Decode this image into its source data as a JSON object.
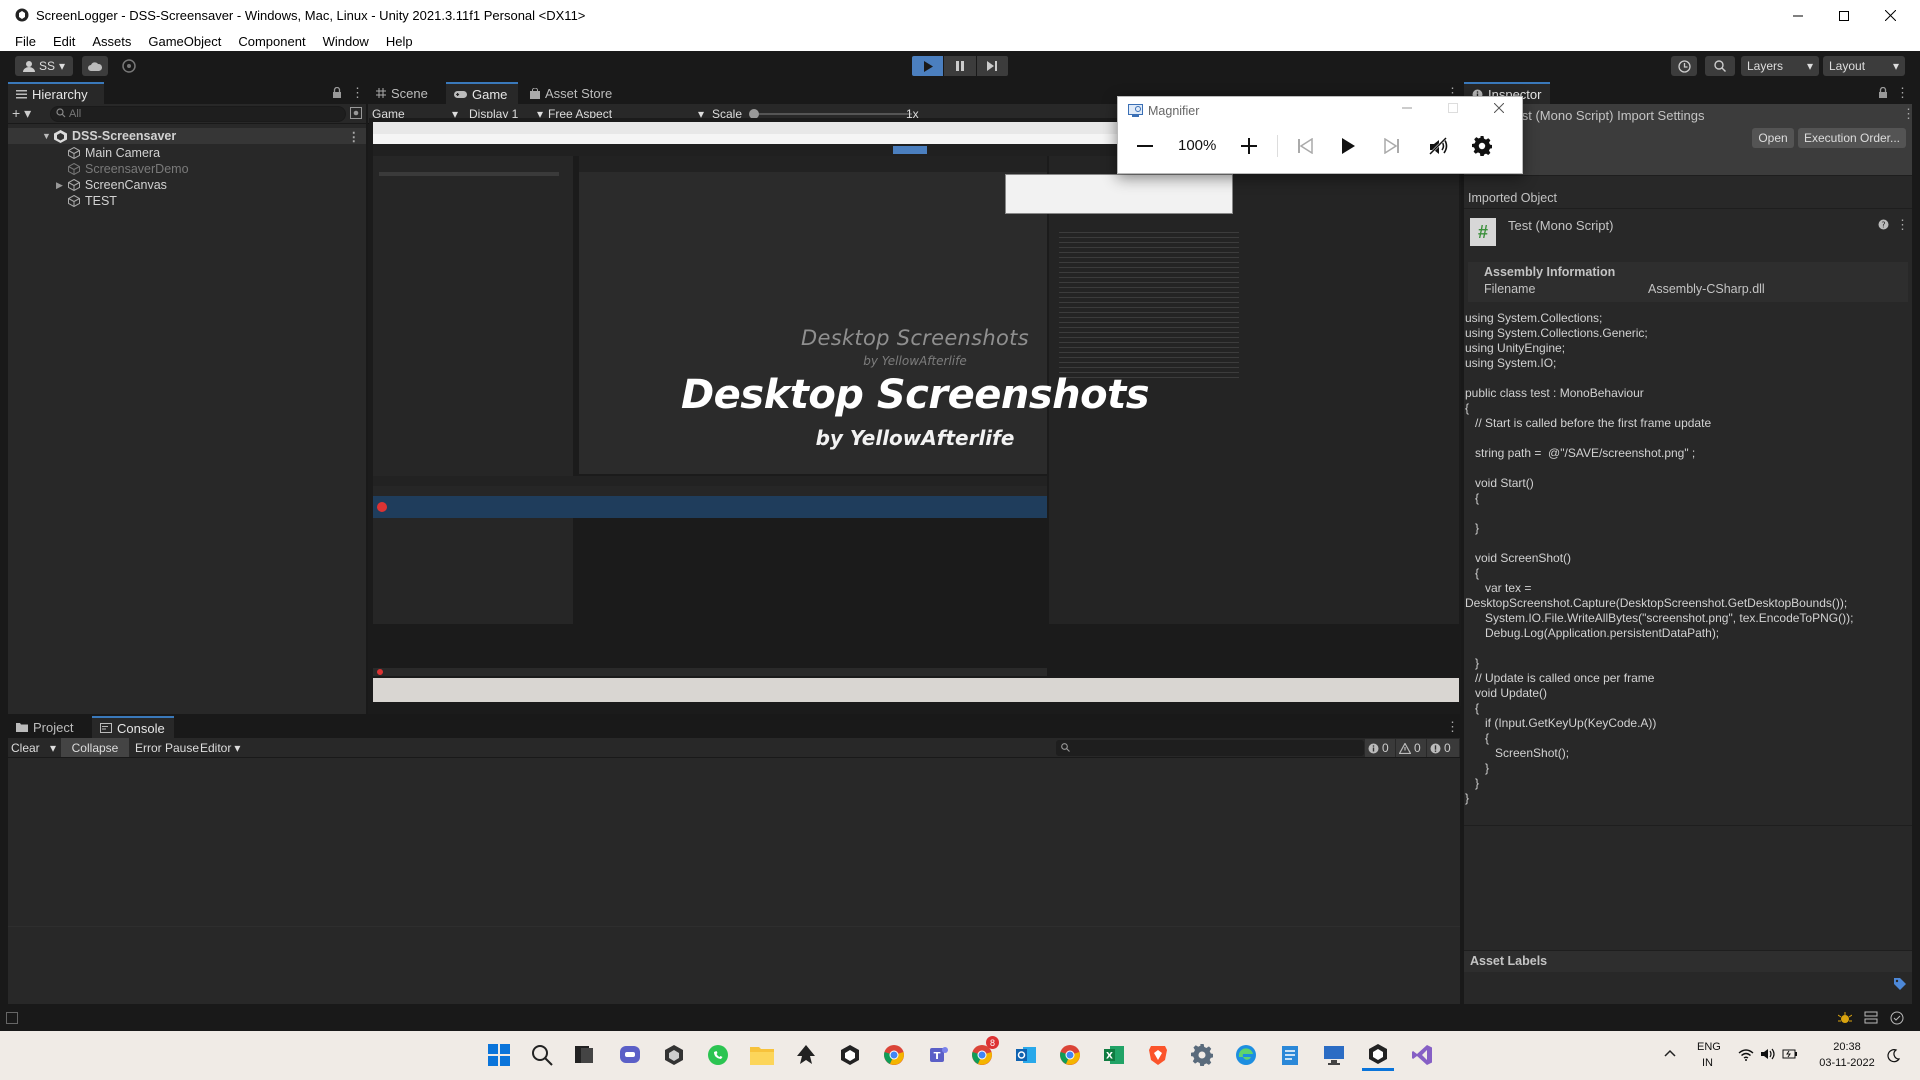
{
  "window": {
    "title": "ScreenLogger - DSS-Screensaver - Windows, Mac, Linux - Unity 2021.3.11f1 Personal <DX11>"
  },
  "menu": [
    "File",
    "Edit",
    "Assets",
    "GameObject",
    "Component",
    "Window",
    "Help"
  ],
  "toolbar": {
    "account_label": "SS",
    "layers_label": "Layers",
    "layout_label": "Layout"
  },
  "hierarchy": {
    "tab": "Hierarchy",
    "search_placeholder": "All",
    "scene": "DSS-Screensaver",
    "items": [
      {
        "label": "Main Camera"
      },
      {
        "label": "ScreensaverDemo"
      },
      {
        "label": "ScreenCanvas"
      },
      {
        "label": "TEST"
      }
    ]
  },
  "center": {
    "tabs": [
      "Scene",
      "Game",
      "Asset Store"
    ],
    "game_dropdown": "Game",
    "display_dropdown": "Display 1",
    "aspect_dropdown": "Free Aspect",
    "scale_label": "Scale",
    "scale_value": "1x"
  },
  "game_view": {
    "small_title": "Desktop Screenshots",
    "small_sub": "by YellowAfterlife",
    "big_title": "Desktop Screenshots",
    "big_sub": "by YellowAfterlife"
  },
  "magnifier": {
    "title": "Magnifier",
    "zoom": "100%",
    "icons": [
      "zoom-out-icon",
      "zoom-in-icon",
      "skip-back-icon",
      "play-icon",
      "skip-forward-icon",
      "read-aloud-icon",
      "settings-icon"
    ]
  },
  "inspector": {
    "tab": "Inspector",
    "header": "Test (Mono Script) Import Settings",
    "open_btn": "Open",
    "exec_btn": "Execution Order...",
    "imported_object": "Imported Object",
    "object_name": "Test (Mono Script)",
    "assembly_info": "Assembly Information",
    "filename_label": "Filename",
    "filename_value": "Assembly-CSharp.dll",
    "code": "using System.Collections;\nusing System.Collections.Generic;\nusing UnityEngine;\nusing System.IO;\n\npublic class test : MonoBehaviour\n{\n   // Start is called before the first frame update\n\n   string path =  @\"/SAVE/screenshot.png\" ;\n\n   void Start()\n   {\n\n   }\n\n   void ScreenShot()\n   {\n      var tex =\nDesktopScreenshot.Capture(DesktopScreenshot.GetDesktopBounds());\n      System.IO.File.WriteAllBytes(\"screenshot.png\", tex.EncodeToPNG());\n      Debug.Log(Application.persistentDataPath);\n\n   }\n   // Update is called once per frame\n   void Update()\n   {\n      if (Input.GetKeyUp(KeyCode.A))\n      {\n         ScreenShot();\n      }\n   }\n}",
    "asset_labels": "Asset Labels"
  },
  "bottom": {
    "tabs": [
      "Project",
      "Console"
    ],
    "clear": "Clear",
    "collapse": "Collapse",
    "error_pause": "Error Pause",
    "editor": "Editor",
    "count_errors": "0",
    "count_warnings": "0",
    "count_info": "0"
  },
  "taskbar": {
    "lang": "ENG",
    "region": "IN",
    "time": "20:38",
    "date": "03-11-2022",
    "badge": "8"
  },
  "colors": {
    "unity_dark": "#282828",
    "unity_darker": "#191919",
    "accent_blue": "#3a79bb",
    "play_blue": "#4b7fbf"
  }
}
